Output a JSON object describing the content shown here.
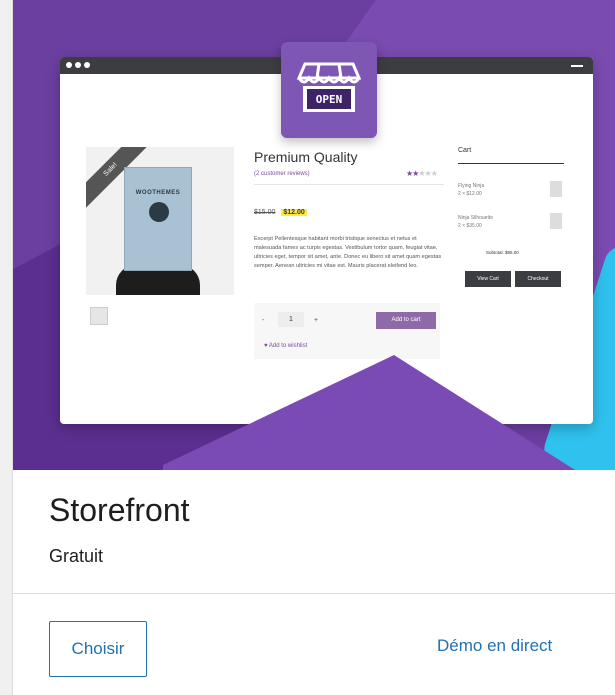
{
  "theme": {
    "name": "Storefront",
    "price": "Gratuit",
    "choose_label": "Choisir",
    "demo_label": "Démo en direct"
  },
  "preview": {
    "badge_text": "OPEN",
    "sale_ribbon": "Sale!",
    "poster_text": "WOOTHEMES",
    "product_title": "Premium Quality",
    "reviews": "(2 customer reviews)",
    "rating": 2,
    "rating_max": 5,
    "old_price": "$15.00",
    "new_price": "$12.00",
    "description": "Excerpt Pellentesque habitant morbi tristique senectus et netus et malesuada fames ac turpis egestas. Vestibulum tortor quam, feugiat vitae, ultricies eget, tempor sit amet, ante. Donec eu libero sit amet quam egestas semper. Aenean ultricies mi vitae est. Mauris placerat eleifend leo.",
    "quantity": "1",
    "minus": "-",
    "plus": "+",
    "add_to_cart": "Add to cart",
    "wishlist": "Add to wishlist",
    "cart": {
      "title": "Cart",
      "items": [
        {
          "name": "Flying Ninja",
          "qty": "2 × $12.00"
        },
        {
          "name": "Ninja Silhouette",
          "qty": "2 × $35.00"
        }
      ],
      "subtotal": "Subtotal: $95.00",
      "view_cart": "View Cart",
      "checkout": "Checkout"
    }
  },
  "colors": {
    "hero_purple": "#6b3fa0",
    "accent_blue": "#2271b1",
    "badge_purple": "#7d57b3",
    "cyan_shape": "#2fc2ee"
  }
}
